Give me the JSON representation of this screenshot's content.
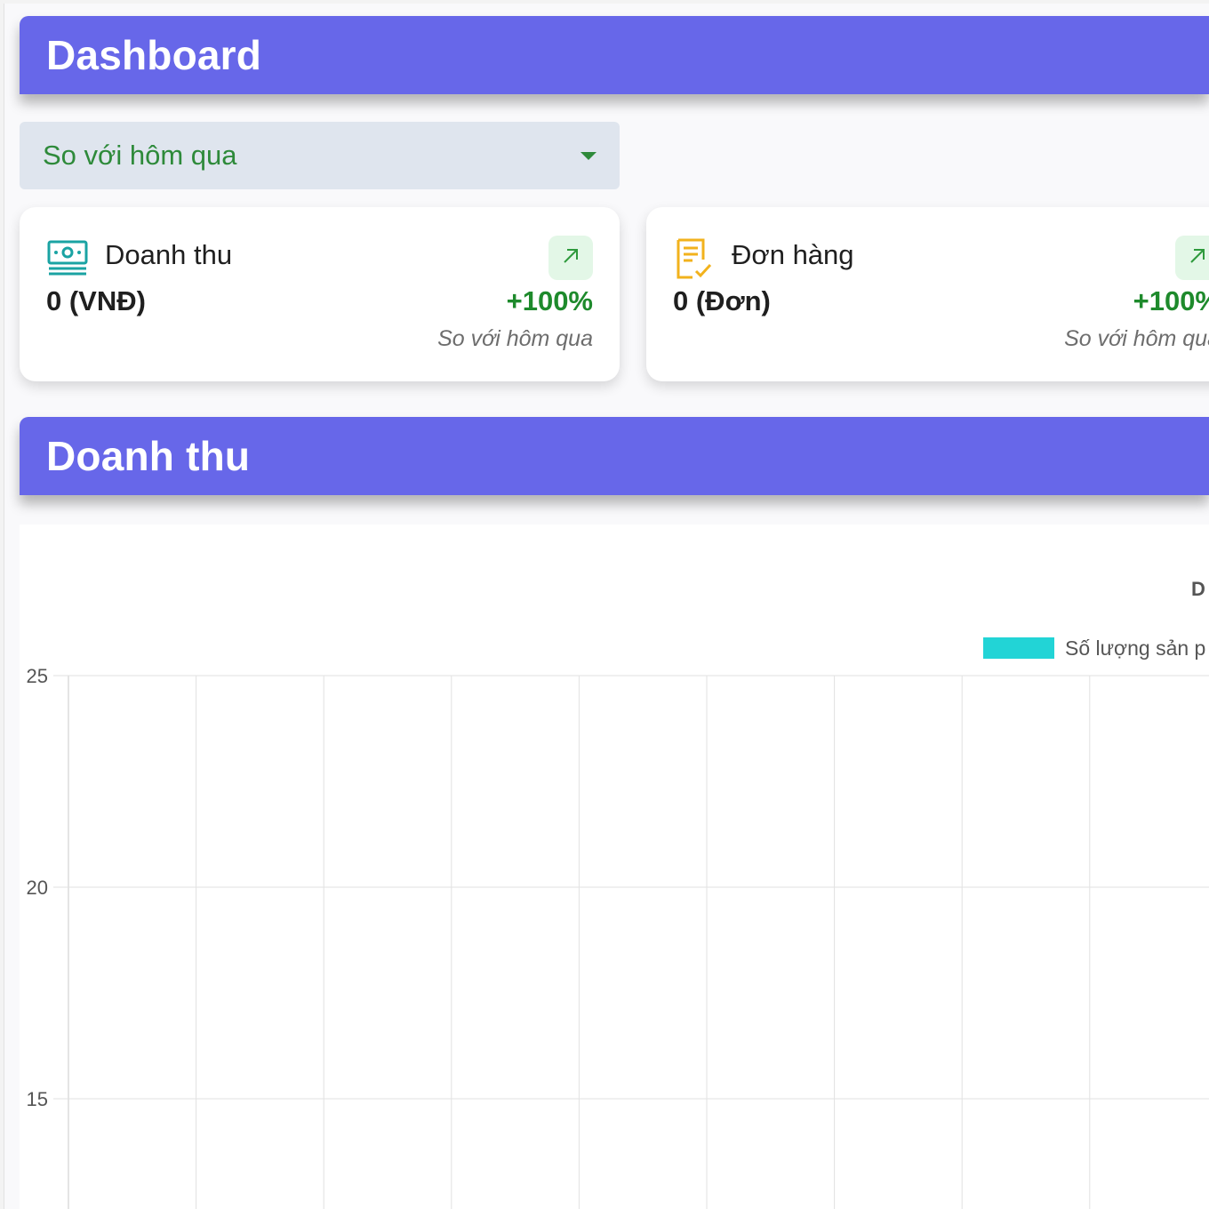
{
  "dashboard": {
    "title": "Dashboard"
  },
  "filter": {
    "selected": "So với hôm qua"
  },
  "cards": [
    {
      "label": "Doanh thu",
      "value": "0 (VNĐ)",
      "change": "+100%",
      "compare": "So với hôm qua",
      "icon": "banknote-icon",
      "accent": "#1aa3a3"
    },
    {
      "label": "Đơn hàng",
      "value": "0 (Đơn)",
      "change": "+100%",
      "compare": "So với hôm qua",
      "icon": "order-checklist-icon",
      "accent": "#f2b21c"
    }
  ],
  "revenue_section": {
    "title": "Doanh thu"
  },
  "colors": {
    "header": "#6767e9",
    "positive": "#1e8a2c",
    "series": "#22d4d6",
    "grid": "#e2e2e2"
  },
  "chart_data": {
    "type": "bar",
    "title": "D",
    "series": [
      {
        "name": "Số lượng sản p",
        "values": []
      }
    ],
    "y_ticks": [
      25,
      20,
      15
    ],
    "grid": true,
    "legend": "top"
  }
}
